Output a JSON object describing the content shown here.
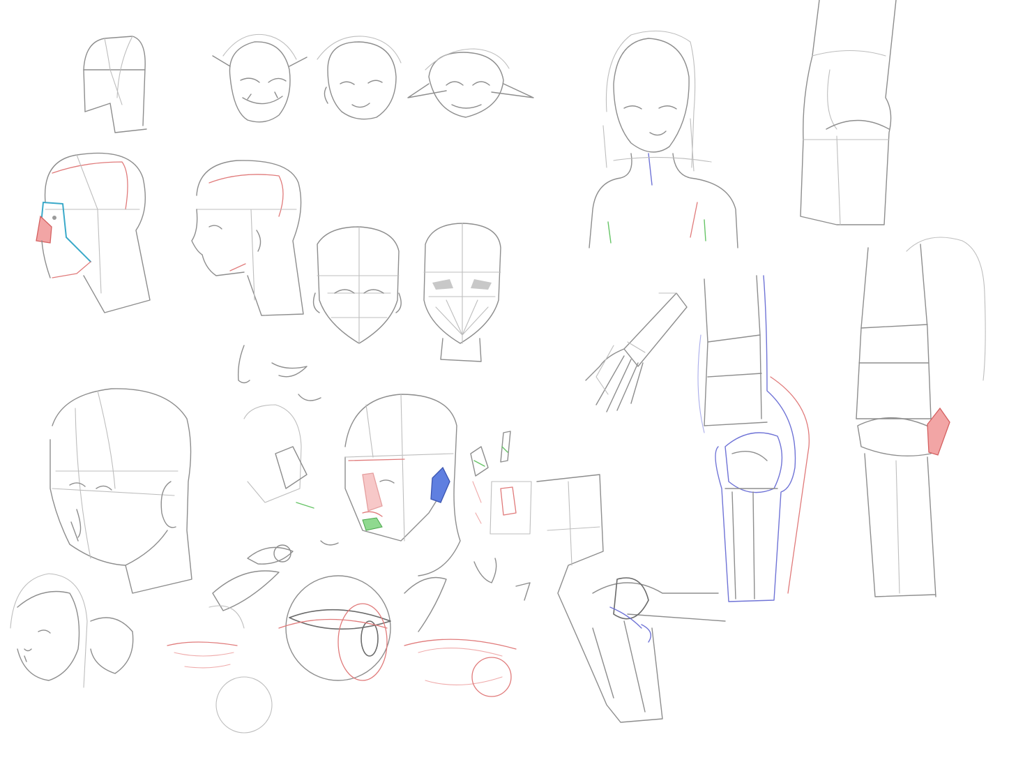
{
  "canvas": {
    "background": "#ffffff",
    "stroke_colors": {
      "pencil": "#8d8d8d",
      "pencil_light": "#bdbdbd",
      "accent_red": "#e07a7a",
      "accent_blue": "#6f73d6",
      "accent_cyan": "#3aa9c9",
      "accent_green": "#66c466"
    }
  },
  "sketches": [
    "head-box-study",
    "orc-head-sketch",
    "boy-head-sketch",
    "goblin-head-sketch",
    "profile-head-colored",
    "profile-head-plain",
    "front-head-construction",
    "front-head-construction-shaded",
    "girl-bust-sketch",
    "hips-box-study",
    "hand-arm-sketch",
    "knee-side-study",
    "knee-back-study",
    "three-quarter-head",
    "nose-mouth-study",
    "head-feature-planes",
    "feature-thumbnails",
    "girl-face-small",
    "eye-studies",
    "lashes-study",
    "eyeball-study",
    "bent-arm-study"
  ]
}
